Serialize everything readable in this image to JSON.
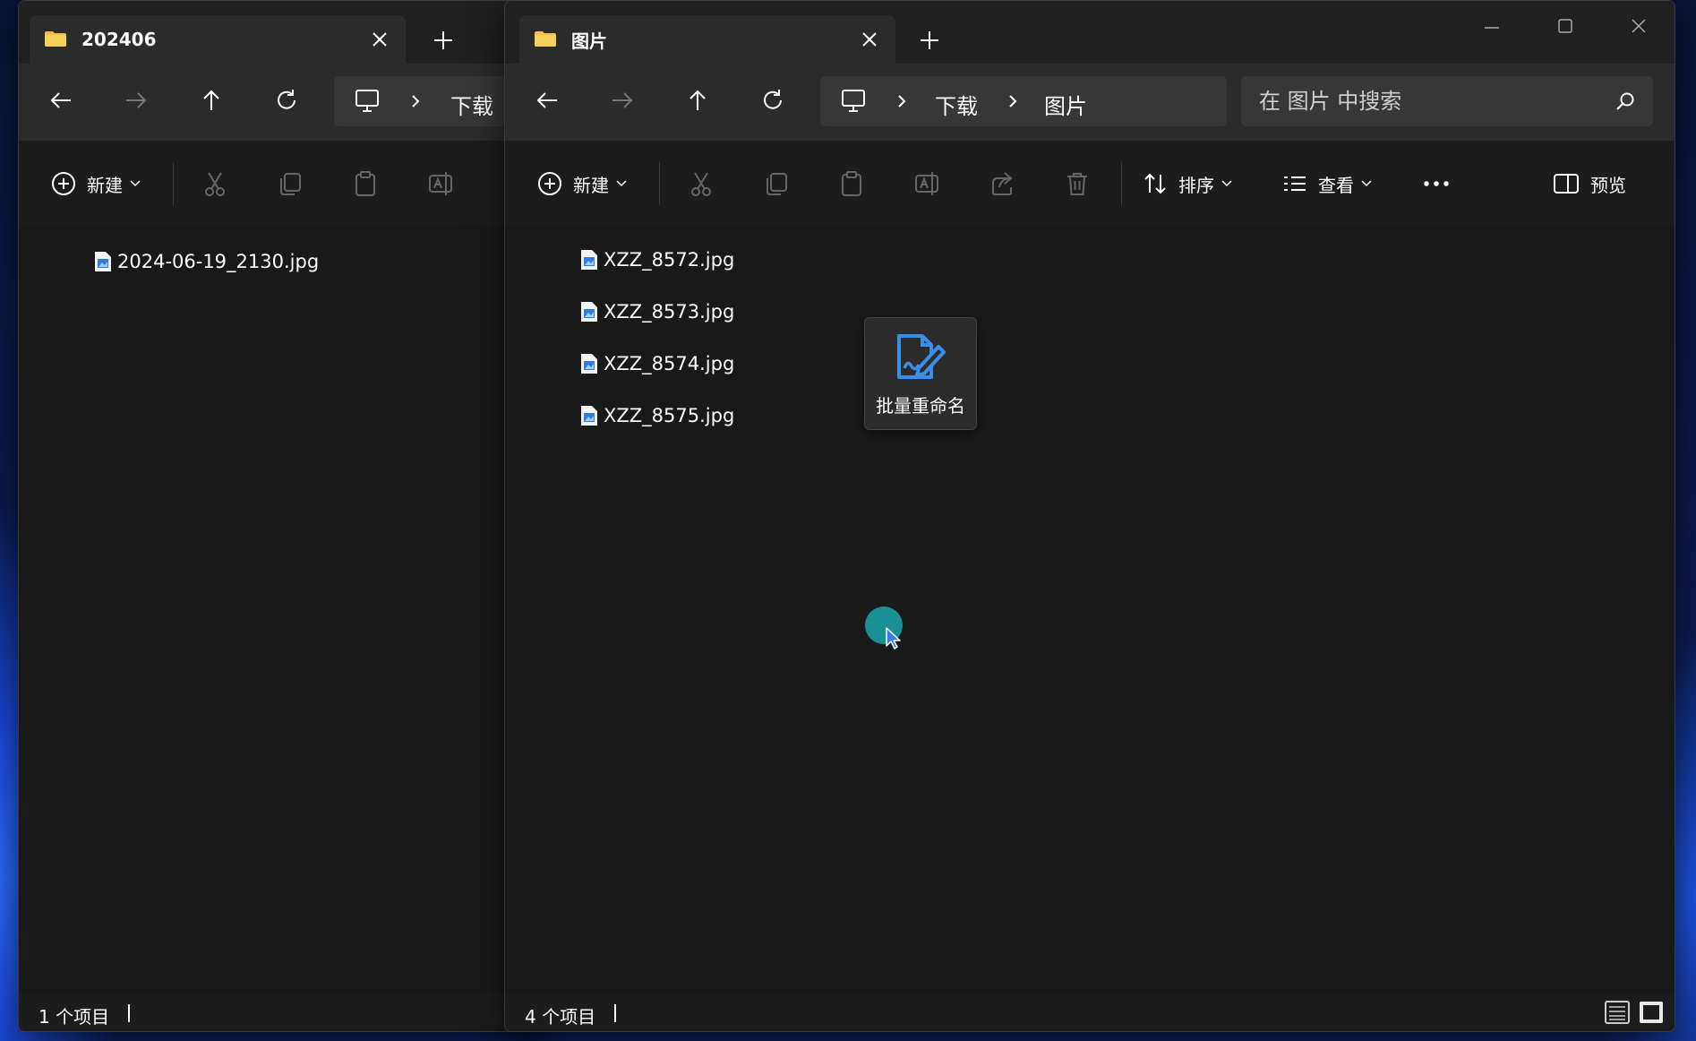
{
  "left_window": {
    "tab_title": "202406",
    "breadcrumb": [
      "下载"
    ],
    "toolbar": {
      "new_label": "新建"
    },
    "files": [
      "2024-06-19_2130.jpg"
    ],
    "status": "1 个项目"
  },
  "right_window": {
    "tab_title": "图片",
    "breadcrumb": [
      "下载",
      "图片"
    ],
    "search": {
      "placeholder": "在 图片 中搜索"
    },
    "toolbar": {
      "new_label": "新建",
      "sort_label": "排序",
      "view_label": "查看",
      "more_label": "···",
      "preview_label": "预览"
    },
    "files": [
      "XZZ_8572.jpg",
      "XZZ_8573.jpg",
      "XZZ_8574.jpg",
      "XZZ_8575.jpg"
    ],
    "status": "4 个项目"
  },
  "drag_tile": {
    "label": "批量重命名",
    "icon": "edit-document-icon"
  },
  "colors": {
    "accent": "#3b8ee8",
    "cursor_highlight": "#1a8f94",
    "folder": "#f0c044"
  }
}
